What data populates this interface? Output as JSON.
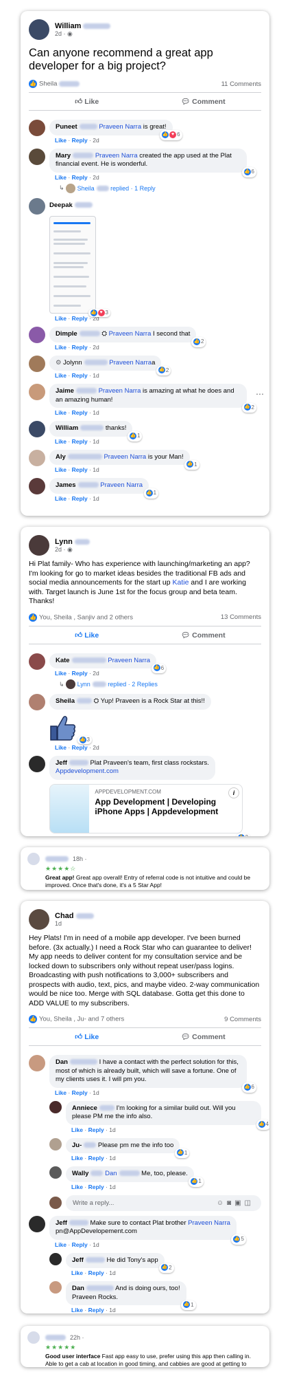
{
  "post1": {
    "author": "William",
    "time": "2d ·",
    "text": "Can anyone recommend a great app developer for a big project?",
    "reactors": "Sheila",
    "comment_count": "11 Comments",
    "like_label": "Like",
    "comment_label": "Comment",
    "comments": [
      {
        "name": "Puneet",
        "mention": "Praveen Narra",
        "text": " is great!",
        "time": "2d",
        "react": "6"
      },
      {
        "name": "Mary",
        "mention": "Praveen Narra",
        "text": " created the app used at the Plat financial event. He is wonderful.",
        "time": "2d",
        "react": "6"
      },
      {
        "name": "Deepak",
        "time": "2d",
        "react": "3"
      },
      {
        "name": "Dimple",
        "mention": "Praveen Narra",
        "text": " I second that",
        "time": "2d",
        "react": "2"
      },
      {
        "name": "Jolynn",
        "mention": "Praveen Narra",
        "text": "a",
        "time": "1d",
        "react": "2"
      },
      {
        "name": "Jaime",
        "mention": "Praveen Narra",
        "text": " is amazing at what he does and an amazing human!",
        "time": "1d",
        "react": "2"
      },
      {
        "name": "William",
        "text": "thanks!",
        "time": "1d",
        "react": "1"
      },
      {
        "name": "Aly",
        "mention": "Praveen Narra",
        "text": " is your Man!",
        "time": "1d",
        "react": "1"
      },
      {
        "name": "James",
        "mention": "Praveen Narra",
        "text": "",
        "time": "1d",
        "react": "1"
      }
    ],
    "replied": {
      "name": "Sheila",
      "text": "replied · 1 Reply"
    }
  },
  "post2": {
    "author": "Lynn",
    "time": "2d ·",
    "text_before": "Hi Plat family- Who has experience with launching/marketing an app? I'm looking for go to market ideas besides the traditional FB ads and social media announcements for the start up ",
    "text_mention": "Katie",
    "text_after": " and I are working with. Target launch is June 1st for the focus group and beta team. Thanks!",
    "reactors": "You, Sheila , Sanjiv  and 2 others",
    "comment_count": "13 Comments",
    "like_label": "Like",
    "comment_label": "Comment",
    "comments": [
      {
        "name": "Kate",
        "mention": "Praveen Narra",
        "time": "2d",
        "react": "6"
      },
      {
        "name": "Sheila",
        "text": "Yup! Praveen is a Rock Star at this!!",
        "time": "2d",
        "react": "3"
      },
      {
        "name": "Jeff",
        "text": "Plat Praveen's team, first class rockstars.",
        "link": "Appdevelopment.com",
        "time": "2d",
        "react": "2"
      }
    ],
    "replied": {
      "name": "Lynn",
      "text": "replied · 2 Replies"
    },
    "link_card": {
      "domain": "APPDEVELOPMENT.COM",
      "title": "App Development | Developing iPhone Apps | Appdevelopment"
    }
  },
  "review1": {
    "time": "18h ·",
    "stars": "★★★★☆",
    "bold": "Great app!",
    "text": " Great app overall! Entry of referral code is not intuitive and could be improved. Once that's done, it's a 5 Star App!"
  },
  "post3": {
    "author": "Chad",
    "time": "1d",
    "text": "Hey Plats! I'm in need of a mobile app developer. I've been burned before. (3x actually.) I need a Rock Star who can guarantee to deliver! My app needs to deliver content for my consultation service and be locked down to subscribers only without repeat user/pass logins. Broadcasting with push notifications to 3,000+ subscribers and prospects with audio, text, pics, and maybe video. 2-way communication would be nice too. Merge with SQL database. Gotta get this done to ADD VALUE to my subscribers.",
    "reactors": "You, Sheila , Ju-  and 7 others",
    "comment_count": "9 Comments",
    "like_label": "Like",
    "comment_label": "Comment",
    "comments": [
      {
        "name": "Dan",
        "text": "I have a contact with the perfect solution for this, most of which is already built, which will save a fortune. One of my clients uses it. I will pm you.",
        "time": "1d",
        "react": "6"
      },
      {
        "name": "Anniece",
        "text": "I'm looking for a similar build out. Will you please PM me the info also.",
        "time": "1d",
        "react": "4"
      },
      {
        "name": "Ju-",
        "text": "Please pm me the info too",
        "time": "1d",
        "react": "1"
      },
      {
        "name": "Wally",
        "mention": "Dan",
        "text": " Me, too, please.",
        "time": "1d",
        "react": "1"
      },
      {
        "name": "Jeff",
        "text": "Make sure to contact Plat brother ",
        "mention": "Praveen Narra",
        "text2": "pn@AppDevelopement.com",
        "time": "1d",
        "react": "5"
      },
      {
        "name": "Jeff",
        "text": "He did Tony's app",
        "time": "1d",
        "react": "2"
      },
      {
        "name": "Dan",
        "text": "And is doing ours, too!",
        "text2": "Praveen Rocks.",
        "time": "1d",
        "react": "1"
      }
    ],
    "reply_placeholder": "Write a reply...",
    "meta_like": "Like",
    "meta_reply": "Reply"
  },
  "review2": {
    "time": "22h ·",
    "stars": "★★★★★",
    "bold": "Good user interface",
    "text": " Fast app easy to use, prefer using this app then calling in. Able to get a cab at location in good timing, and cabbies are good at getting to location fast."
  },
  "labels": {
    "like": "Like",
    "reply": "Reply",
    "sep": " · "
  },
  "colors": {
    "accent": "#1877f2",
    "heart": "#f33e58",
    "bubble": "#f0f2f5"
  }
}
